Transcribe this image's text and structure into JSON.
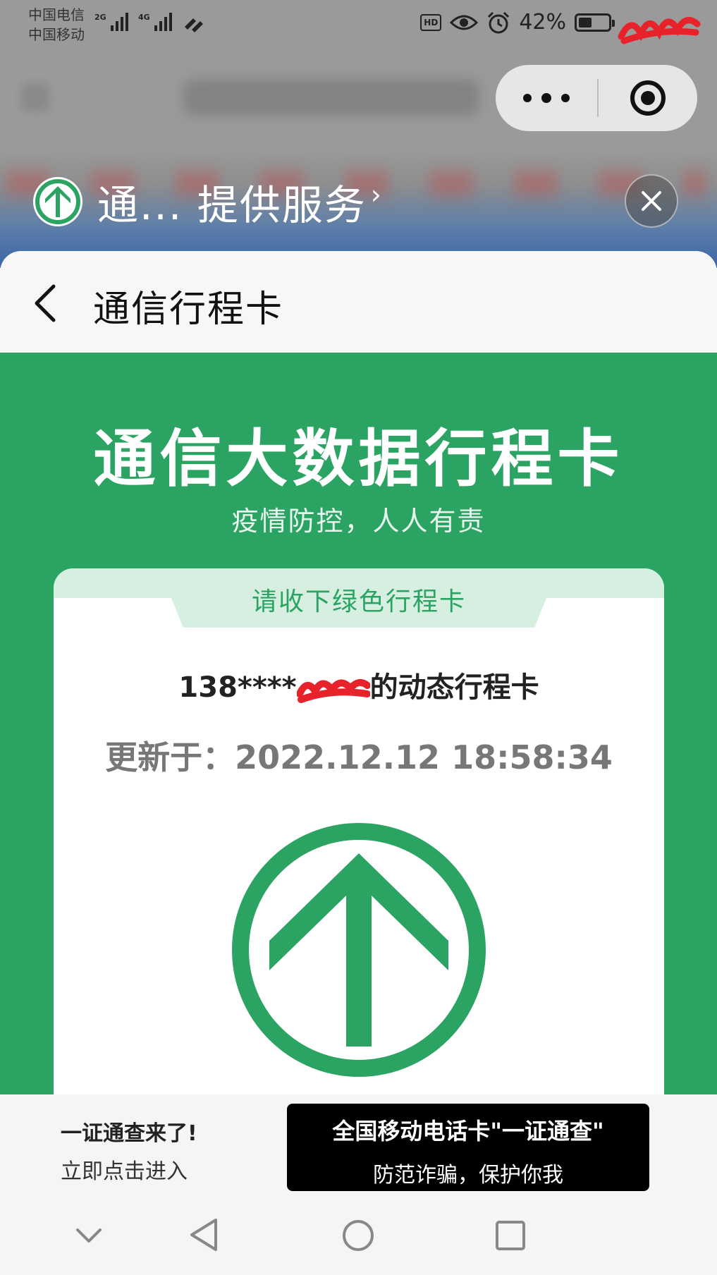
{
  "status_bar": {
    "carrier_1": "中国电信",
    "carrier_2": "中国移动",
    "network_1": "2G",
    "network_2": "4G",
    "hd_badge": "HD",
    "battery": "42%"
  },
  "provider": {
    "label": "通...  提供服务",
    "chevron": "›"
  },
  "nav": {
    "title": "通信行程卡"
  },
  "hero": {
    "title": "通信大数据行程卡",
    "subtitle": "疫情防控，人人有责"
  },
  "card": {
    "tab_label": "请收下绿色行程卡",
    "phone_prefix": "138****",
    "phone_suffix": "的动态行程卡",
    "updated": "更新于：2022.12.12 18:58:34"
  },
  "promo": {
    "line1": "一证通查来了!",
    "line2": "立即点击进入",
    "button_line1": "全国移动电话卡\"一证通查\"",
    "button_line2": "防范诈骗，保护你我"
  },
  "colors": {
    "brand_green": "#2ba463",
    "light_green": "#d6efe1"
  }
}
